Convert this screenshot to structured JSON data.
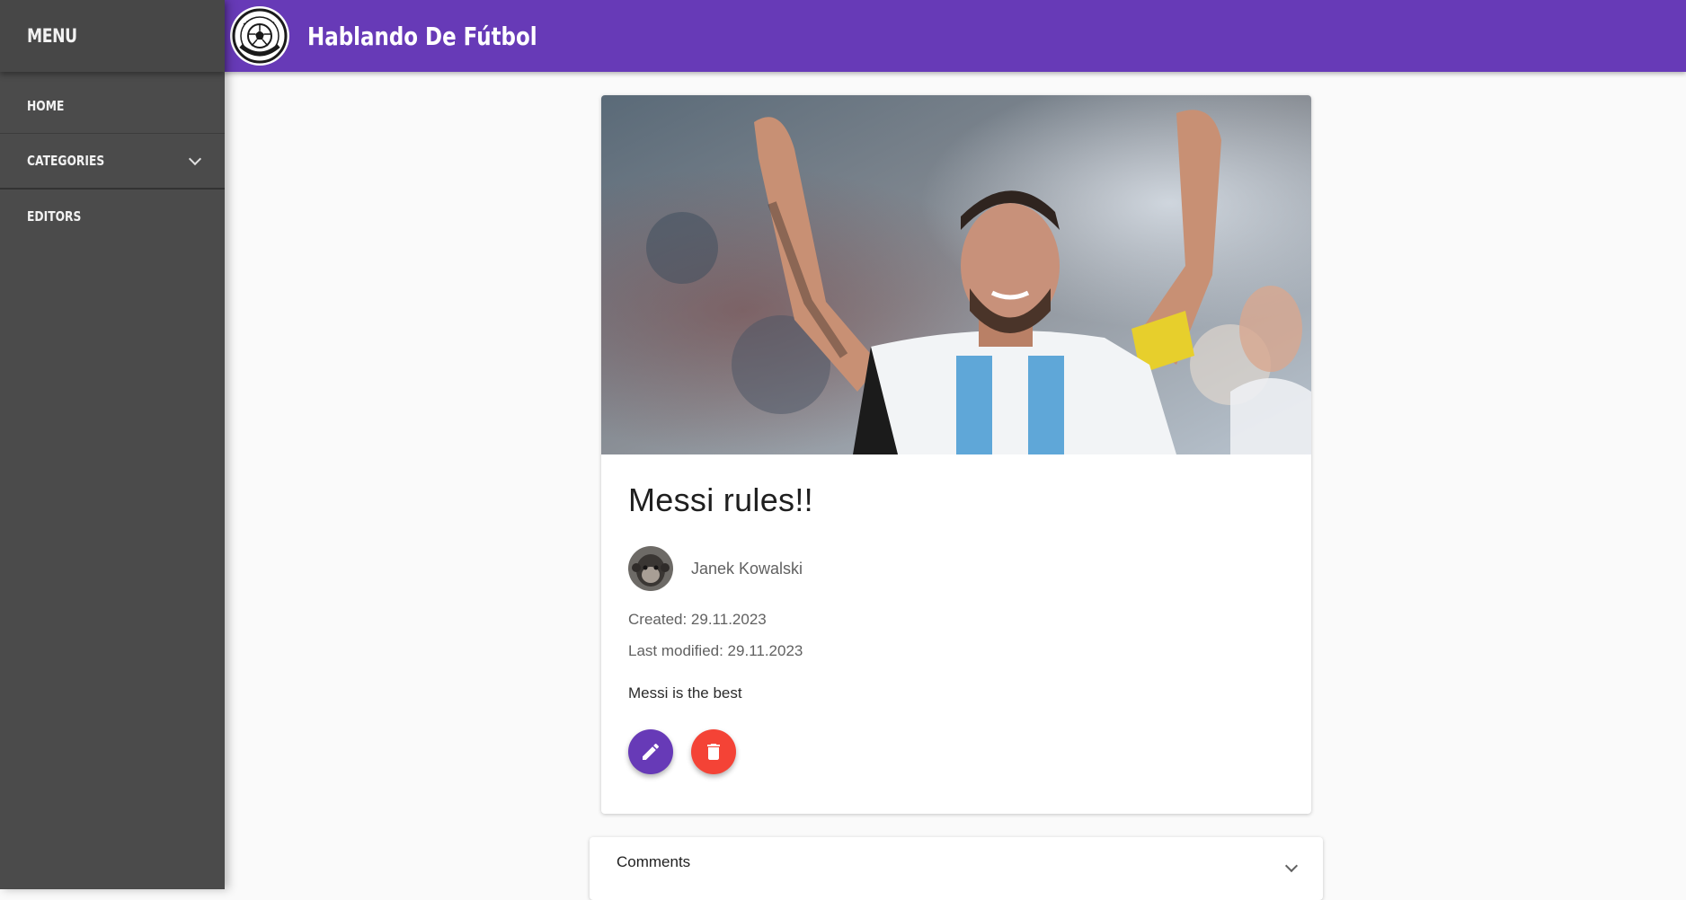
{
  "sidebar": {
    "title": "MENU",
    "items": [
      {
        "label": "HOME"
      },
      {
        "label": "CATEGORIES",
        "icon": "chevron-down-icon"
      },
      {
        "label": "EDITORS"
      }
    ]
  },
  "header": {
    "logo_icon": "soccer-ball-logo-icon",
    "title": "Hablando De Fútbol",
    "background": "#673ab7"
  },
  "post": {
    "title": "Messi rules!!",
    "author": "Janek Kowalski",
    "created": "Created: 29.11.2023",
    "modified": "Last modified: 29.11.2023",
    "body": "Messi is the best",
    "edit_icon": "pencil-icon",
    "delete_icon": "trash-icon",
    "edit_color": "#673ab7",
    "delete_color": "#f44336"
  },
  "comments": {
    "label": "Comments",
    "icon": "chevron-down-icon"
  }
}
